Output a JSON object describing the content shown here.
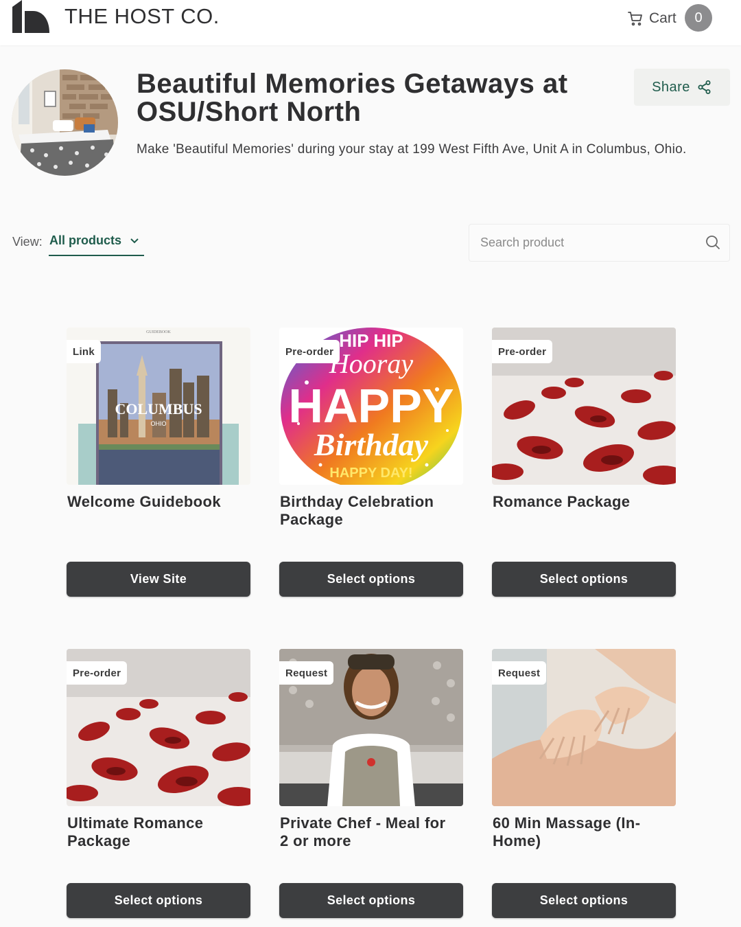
{
  "header": {
    "brand": "THE HOST CO.",
    "cart_label": "Cart",
    "cart_count": "0"
  },
  "property": {
    "title": "Beautiful Memories Getaways at OSU/Short North",
    "description": "Make 'Beautiful Memories' during your stay at 199 West Fifth Ave, Unit A in Columbus, Ohio.",
    "share_label": "Share"
  },
  "filter": {
    "view_label": "View:",
    "view_value": "All products"
  },
  "search": {
    "placeholder": "Search product"
  },
  "products": [
    {
      "badge": "Link",
      "title": "Welcome Guidebook",
      "button": "View Site",
      "image": "columbus-guidebook-cover",
      "cover_small": "GUIDEBOOK",
      "cover_city": "COLUMBUS",
      "cover_state": "OHIO"
    },
    {
      "badge": "Pre-order",
      "title": "Birthday Celebration Package",
      "button": "Select options",
      "image": "happy-birthday-balloon",
      "balloon_top": "HIP HIP",
      "balloon_hooray": "Hooray",
      "balloon_happy": "HAPPY",
      "balloon_birthday": "Birthday",
      "balloon_bottom": "HAPPY DAY!"
    },
    {
      "badge": "Pre-order",
      "title": "Romance Package",
      "button": "Select options",
      "image": "rose-petals"
    },
    {
      "badge": "Pre-order",
      "title": "Ultimate Romance Package",
      "button": "Select options",
      "image": "rose-petals"
    },
    {
      "badge": "Request",
      "title": "Private Chef - Meal for 2 or more",
      "button": "Select options",
      "image": "chef-portrait"
    },
    {
      "badge": "Request",
      "title": "60 Min Massage (In-Home)",
      "button": "Select options",
      "image": "massage-hands"
    }
  ],
  "colors": {
    "accent": "#1f5c4c",
    "button": "#3d3e40",
    "cart_badge": "#8c8c8e"
  }
}
